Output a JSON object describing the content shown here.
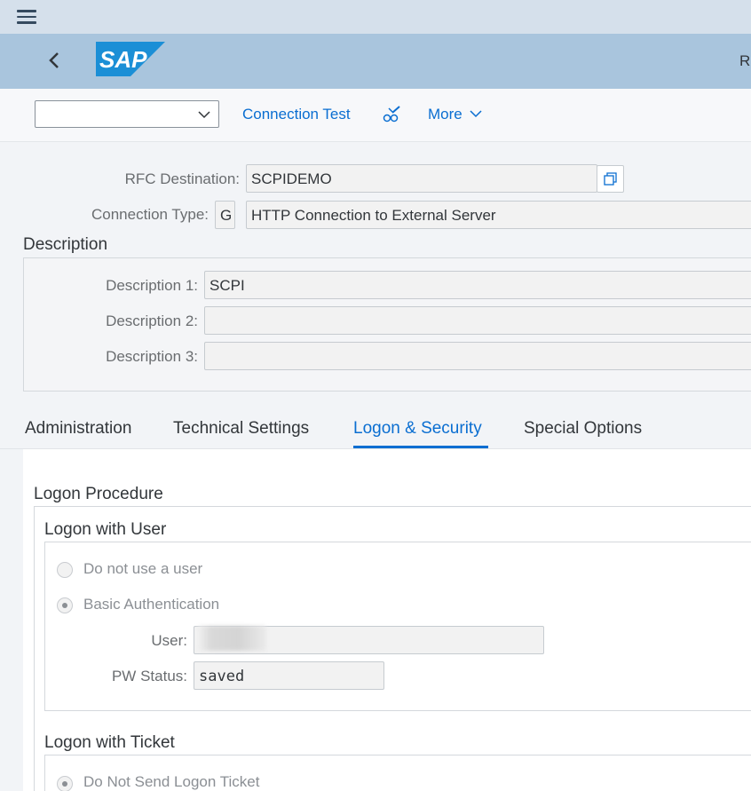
{
  "shell": {
    "menu_icon": "hamburger-icon",
    "back_icon": "back-chevron-icon",
    "logo_text": "SAP",
    "right_text": "R"
  },
  "toolbar": {
    "select_value": "",
    "connection_test_label": "Connection Test",
    "edit_icon": "glasses-pencil-icon",
    "more_label": "More"
  },
  "header": {
    "rfc_destination_label": "RFC Destination:",
    "rfc_destination_value": "SCPIDEMO",
    "connection_type_label": "Connection Type:",
    "connection_type_code": "G",
    "connection_type_text": "HTTP Connection to External Server"
  },
  "description": {
    "title": "Description",
    "d1_label": "Description 1:",
    "d1_value": "SCPI",
    "d2_label": "Description 2:",
    "d2_value": "",
    "d3_label": "Description 3:",
    "d3_value": ""
  },
  "tabs": [
    {
      "label": "Administration"
    },
    {
      "label": "Technical Settings"
    },
    {
      "label": "Logon & Security"
    },
    {
      "label": "Special Options"
    }
  ],
  "logon": {
    "procedure_title": "Logon Procedure",
    "with_user_title": "Logon with User",
    "opt_no_user": "Do not use a user",
    "opt_basic_auth": "Basic Authentication",
    "selected_option": "Basic Authentication",
    "user_label": "User:",
    "pw_status_label": "PW Status:",
    "pw_status_value": "saved",
    "with_ticket_title": "Logon with Ticket",
    "opt_no_ticket": "Do Not Send Logon Ticket"
  },
  "colors": {
    "shell": "#a9c5dd",
    "top": "#d5e0eb",
    "accent": "#0a6ed1"
  }
}
